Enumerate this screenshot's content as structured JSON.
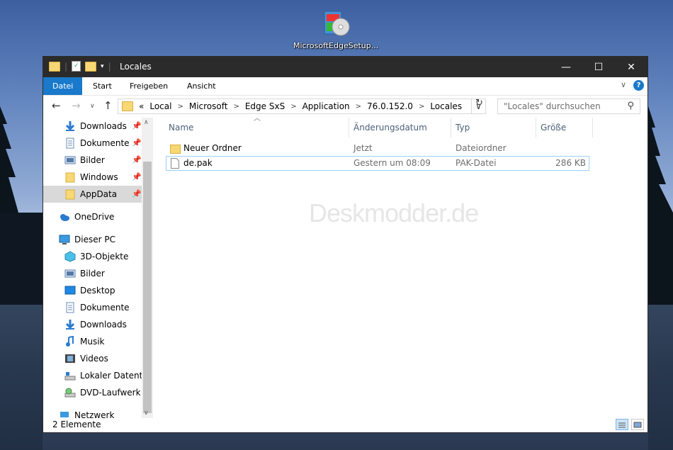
{
  "desktop": {
    "icon_label": "MicrosoftEdgeSetup..."
  },
  "window": {
    "title": "Locales",
    "controls": {
      "minimize": "—",
      "maximize": "☐",
      "close": "✕"
    }
  },
  "ribbon": {
    "tabs": [
      "Datei",
      "Start",
      "Freigeben",
      "Ansicht"
    ],
    "active_tab": "Datei",
    "expand_icon": "chevron-down-icon",
    "help_label": "?"
  },
  "address": {
    "prefix": "«",
    "crumbs": [
      "Local",
      "Microsoft",
      "Edge SxS",
      "Application",
      "76.0.152.0",
      "Locales"
    ],
    "separator": ">"
  },
  "search": {
    "placeholder": "\"Locales\" durchsuchen"
  },
  "nav": {
    "quick_access": [
      {
        "label": "Downloads",
        "icon": "download-arrow-icon",
        "pinned": true
      },
      {
        "label": "Dokumente",
        "icon": "document-icon",
        "pinned": true
      },
      {
        "label": "Bilder",
        "icon": "pictures-icon",
        "pinned": true
      },
      {
        "label": "Windows",
        "icon": "folder-icon",
        "pinned": true
      },
      {
        "label": "AppData",
        "icon": "folder-icon",
        "pinned": true,
        "selected": true
      }
    ],
    "onedrive": "OneDrive",
    "this_pc": "Dieser PC",
    "pc_items": [
      {
        "label": "3D-Objekte",
        "icon": "3d-objects-icon"
      },
      {
        "label": "Bilder",
        "icon": "pictures-icon"
      },
      {
        "label": "Desktop",
        "icon": "desktop-icon"
      },
      {
        "label": "Dokumente",
        "icon": "document-icon"
      },
      {
        "label": "Downloads",
        "icon": "download-arrow-icon"
      },
      {
        "label": "Musik",
        "icon": "music-note-icon"
      },
      {
        "label": "Videos",
        "icon": "video-icon"
      },
      {
        "label": "Lokaler Datenträ",
        "icon": "local-disk-icon"
      },
      {
        "label": "DVD-Laufwerk (I",
        "icon": "dvd-drive-icon"
      }
    ],
    "network": "Netzwerk"
  },
  "columns": [
    "Name",
    "Änderungsdatum",
    "Typ",
    "Größe"
  ],
  "files": [
    {
      "name": "Neuer Ordner",
      "date": "Jetzt",
      "type": "Dateiordner",
      "size": "",
      "icon": "folder-icon"
    },
    {
      "name": "de.pak",
      "date": "Gestern um 08:09",
      "type": "PAK-Datei",
      "size": "286 KB",
      "icon": "file-icon",
      "focused": true
    }
  ],
  "watermark": "Deskmodder.de",
  "status": {
    "count": "2 Elemente"
  }
}
